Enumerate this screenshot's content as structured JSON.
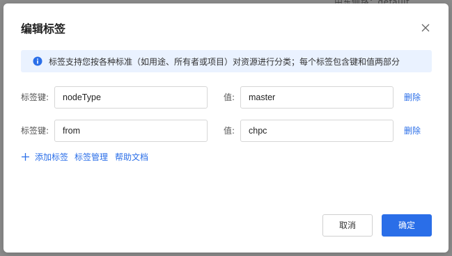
{
  "background": {
    "partial_text": "由东侧路：default"
  },
  "dialog": {
    "title": "编辑标签",
    "info_text": "标签支持您按各种标准（如用途、所有者或项目）对资源进行分类；每个标签包含键和值两部分",
    "key_label": "标签键:",
    "value_label": "值:",
    "delete_label": "删除",
    "tags": [
      {
        "key": "nodeType",
        "value": "master"
      },
      {
        "key": "from",
        "value": "chpc"
      }
    ],
    "actions": {
      "add_tag": "添加标签",
      "manage_tags": "标签管理",
      "help_docs": "帮助文档"
    },
    "buttons": {
      "cancel": "取消",
      "confirm": "确定"
    }
  },
  "colors": {
    "primary": "#2a6ee8",
    "info_bg": "#eaf2ff",
    "overlay": "#8b8b8b"
  },
  "icons": [
    "close-icon",
    "info-icon",
    "plus-icon"
  ]
}
